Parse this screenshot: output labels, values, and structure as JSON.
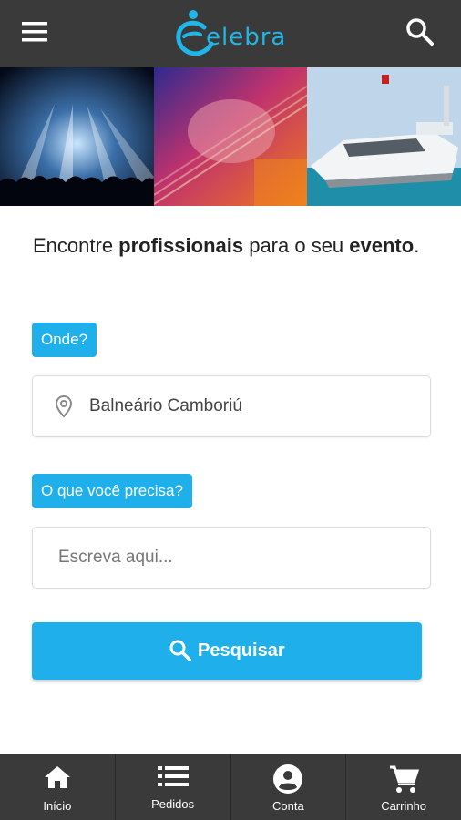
{
  "app": {
    "logo_text": "elebra",
    "logo_color": "#1fb6e8"
  },
  "header": {
    "menu_icon": "menu-icon",
    "search_icon": "search-icon"
  },
  "banner": {
    "images": [
      "concert-stage-image",
      "guitar-player-image",
      "yacht-image"
    ]
  },
  "headline": {
    "part1": "Encontre ",
    "bold1": "profissionais",
    "part2": " para o seu ",
    "bold2": "evento",
    "part3": "."
  },
  "where": {
    "label": "Onde?",
    "value": "Balneário Camboriú",
    "icon": "location-pin-icon"
  },
  "what": {
    "label": "O que você precisa?",
    "placeholder": "Escreva aqui..."
  },
  "search_button": {
    "label": "Pesquisar",
    "icon": "search-icon"
  },
  "nav": {
    "items": [
      {
        "label": "Início",
        "icon": "home-icon"
      },
      {
        "label": "Pedidos",
        "icon": "list-icon"
      },
      {
        "label": "Conta",
        "icon": "account-icon"
      },
      {
        "label": "Carrinho",
        "icon": "cart-icon"
      }
    ]
  },
  "colors": {
    "accent": "#1fb0ec",
    "bar": "#3a3a3a"
  }
}
